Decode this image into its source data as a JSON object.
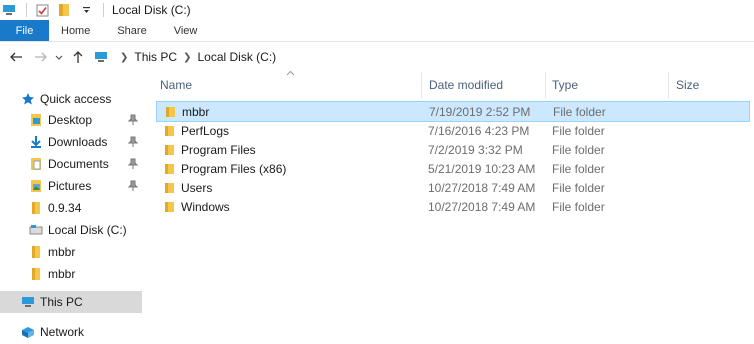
{
  "window": {
    "title": "Local Disk (C:)"
  },
  "ribbon": {
    "tabs": [
      "File",
      "Home",
      "Share",
      "View"
    ]
  },
  "address": {
    "crumbs": [
      "This PC",
      "Local Disk (C:)"
    ]
  },
  "nav": {
    "quick_access": "Quick access",
    "items": [
      "Desktop",
      "Downloads",
      "Documents",
      "Pictures",
      "0.9.34",
      "Local Disk (C:)",
      "mbbr",
      "mbbr"
    ],
    "this_pc": "This PC",
    "network": "Network"
  },
  "columns": {
    "name": "Name",
    "date": "Date modified",
    "type": "Type",
    "size": "Size"
  },
  "files": [
    {
      "name": "mbbr",
      "date": "7/19/2019 2:52 PM",
      "type": "File folder"
    },
    {
      "name": "PerfLogs",
      "date": "7/16/2016 4:23 PM",
      "type": "File folder"
    },
    {
      "name": "Program Files",
      "date": "7/2/2019 3:32 PM",
      "type": "File folder"
    },
    {
      "name": "Program Files (x86)",
      "date": "5/21/2019 10:23 AM",
      "type": "File folder"
    },
    {
      "name": "Users",
      "date": "10/27/2018 7:49 AM",
      "type": "File folder"
    },
    {
      "name": "Windows",
      "date": "10/27/2018 7:49 AM",
      "type": "File folder"
    }
  ],
  "colors": {
    "accent": "#1979ca",
    "selection": "#cce8ff",
    "selection_border": "#99d1ff",
    "folder": "#f4c74a",
    "nav_selected": "#d9d9d9"
  },
  "icons": [
    "computer-icon",
    "properties-icon",
    "folder-icon",
    "dropdown-icon",
    "back-icon",
    "forward-icon",
    "recent-icon",
    "up-icon",
    "star-icon",
    "desktop-icon",
    "downloads-icon",
    "documents-icon",
    "pictures-icon",
    "pin-icon",
    "drive-icon",
    "this-pc-icon",
    "network-icon"
  ]
}
